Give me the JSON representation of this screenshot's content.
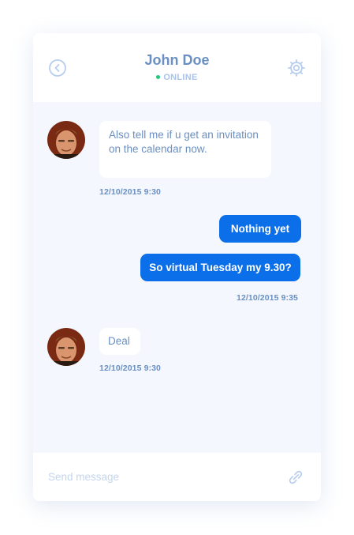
{
  "header": {
    "contact_name": "John Doe",
    "status": "ONLINE",
    "back_icon": "chevron-left-circle-icon",
    "settings_icon": "gear-icon"
  },
  "messages": [
    {
      "direction": "incoming",
      "text": "Also tell me if u get an invitation on the calendar now.",
      "timestamp": "12/10/2015 9:30"
    },
    {
      "direction": "outgoing",
      "text": "Nothing yet"
    },
    {
      "direction": "outgoing",
      "text": "So virtual Tuesday my 9.30?",
      "timestamp": "12/10/2015 9:35"
    },
    {
      "direction": "incoming",
      "text": "Deal",
      "timestamp": "12/10/2015 9:30"
    }
  ],
  "composer": {
    "placeholder": "Send message",
    "attach_icon": "paperclip-icon"
  },
  "colors": {
    "accent_blue": "#0a6fe8",
    "text_blue": "#6a8fc2",
    "online_green": "#22c77a",
    "background": "#f4f8fe"
  }
}
